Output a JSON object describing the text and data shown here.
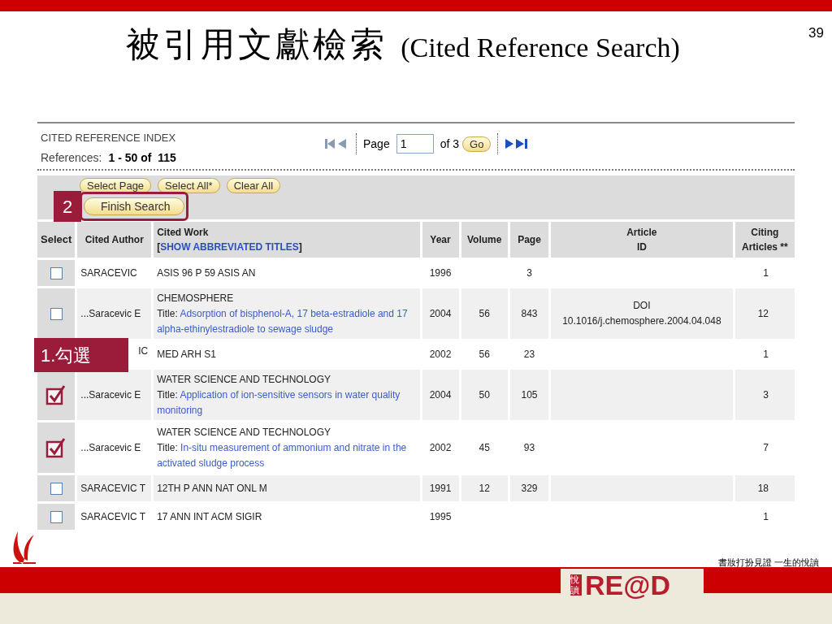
{
  "slide": {
    "title_cjk": "被引用文獻檢索",
    "title_en": "(Cited Reference Search)",
    "page_number": "39"
  },
  "index": {
    "heading": "CITED REFERENCE INDEX",
    "references_label": "References:",
    "references_range": "1 - 50 of  115"
  },
  "pager": {
    "page_label": "Page",
    "page_value": "1",
    "of_label": "of 3",
    "go": "Go"
  },
  "toolbar": {
    "buttons": [
      "Select Page",
      "Select All*",
      "Clear All"
    ],
    "finish": "Finish Search"
  },
  "annotations": {
    "finish_step": "2",
    "check_step": "1.勾選"
  },
  "columns": [
    {
      "label": "Select"
    },
    {
      "label": "Cited Author"
    },
    {
      "label": "Cited Work",
      "link_open": "[",
      "link": "SHOW ABBREVIATED TITLES",
      "link_close": "]"
    },
    {
      "label": "Year"
    },
    {
      "label": "Volume"
    },
    {
      "label": "Page"
    },
    {
      "label": "Article",
      "label_2": "ID"
    },
    {
      "label": "Citing",
      "label_2": "Articles **"
    }
  ],
  "rows": [
    {
      "checked": false,
      "author": "SARACEVIC",
      "work": "ASIS 96 P 59 ASIS AN",
      "year": "1996",
      "volume": "",
      "page": "3",
      "article_id": "",
      "citing": "1"
    },
    {
      "checked": false,
      "author": "...Saracevic E",
      "work": "CHEMOSPHERE",
      "title_label": "Title:",
      "title": "Adsorption of bisphenol-A, 17 beta-estradiole and 17 alpha-ethinylestradiole to sewage sludge",
      "year": "2004",
      "volume": "56",
      "page": "843",
      "article_id": "DOI",
      "article_id_2": "10.1016/j.chemosphere.2004.04.048",
      "citing": "12"
    },
    {
      "author": "IC",
      "work": "MED ARH S1",
      "year": "2002",
      "volume": "56",
      "page": "23",
      "article_id": "",
      "citing": "1"
    },
    {
      "checked": true,
      "author": "...Saracevic E",
      "work": "WATER SCIENCE AND TECHNOLOGY",
      "title_label": "Title:",
      "title": "Application of ion-sensitive sensors in water quality monitoring",
      "year": "2004",
      "volume": "50",
      "page": "105",
      "article_id": "",
      "citing": "3"
    },
    {
      "checked": true,
      "author": "...Saracevic E",
      "work": "WATER SCIENCE AND TECHNOLOGY",
      "title_label": "Title:",
      "title": "In-situ measurement of ammonium and nitrate in the activated sludge process",
      "year": "2002",
      "volume": "45",
      "page": "93",
      "article_id": "",
      "citing": "7"
    },
    {
      "checked": false,
      "author": "SARACEVIC T",
      "work": "12TH P ANN NAT ONL M",
      "year": "1991",
      "volume": "12",
      "page": "329",
      "article_id": "",
      "citing": "18"
    },
    {
      "checked": false,
      "author": "SARACEVIC T",
      "work": "17 ANN INT ACM SIGIR",
      "year": "1995",
      "volume": "",
      "page": "",
      "article_id": "",
      "citing": "1"
    }
  ],
  "footer": {
    "tagline": "書妝打扮見證 一生的悅讀",
    "logo_cjk": "悅讀",
    "logo_text": "RE@D"
  }
}
